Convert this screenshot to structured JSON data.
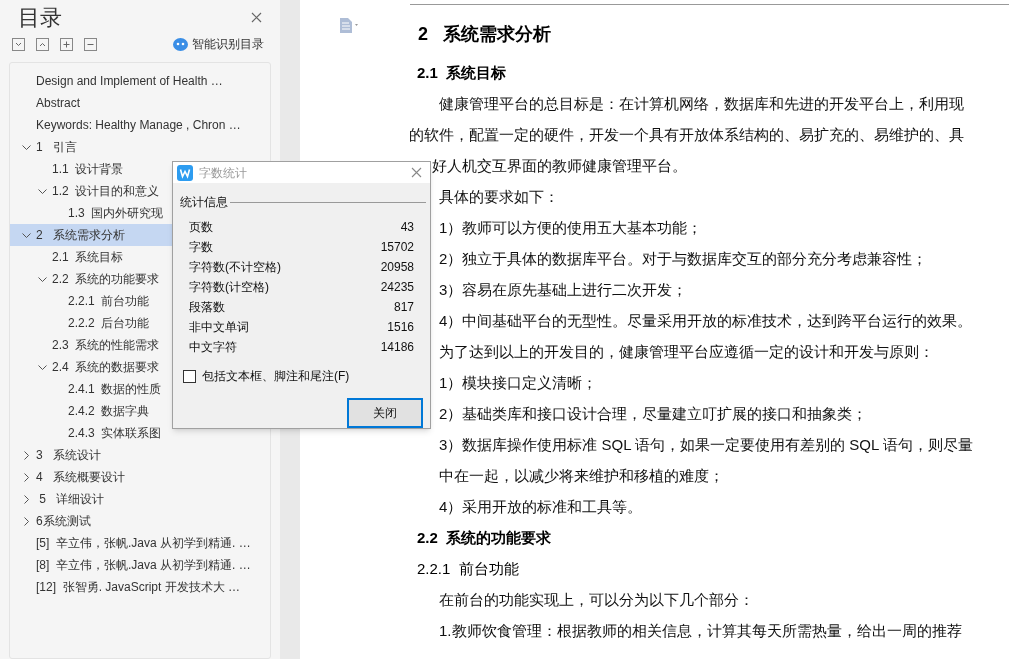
{
  "toc_panel": {
    "title": "目录",
    "smart_button": "智能识别目录",
    "items": [
      {
        "label": "Design and Implement of Health …",
        "selected": false
      },
      {
        "label": "Abstract",
        "selected": false
      },
      {
        "label": "Keywords: Healthy Manage , Chron …",
        "selected": false
      },
      {
        "label": "1   引言",
        "selected": false,
        "expanded": true,
        "children": [
          {
            "label": "1.1  设计背景",
            "selected": false
          },
          {
            "label": "1.2  设计目的和意义",
            "selected": false,
            "expanded": true,
            "children": [
              {
                "label": "1.3  国内外研究现",
                "selected": false
              }
            ]
          }
        ]
      },
      {
        "label": "2   系统需求分析",
        "selected": true,
        "expanded": true,
        "children": [
          {
            "label": "2.1  系统目标",
            "selected": false
          },
          {
            "label": "2.2  系统的功能要求",
            "selected": false,
            "expanded": true,
            "children": [
              {
                "label": "2.2.1  前台功能",
                "selected": false
              },
              {
                "label": "2.2.2  后台功能",
                "selected": false
              }
            ]
          },
          {
            "label": "2.3  系统的性能需求",
            "selected": false
          },
          {
            "label": "2.4  系统的数据要求",
            "selected": false,
            "expanded": true,
            "children": [
              {
                "label": "2.4.1  数据的性质",
                "selected": false
              },
              {
                "label": "2.4.2  数据字典",
                "selected": false
              },
              {
                "label": "2.4.3  实体联系图",
                "selected": false
              }
            ]
          }
        ]
      },
      {
        "label": "3   系统设计",
        "selected": false,
        "expanded": false
      },
      {
        "label": "4   系统概要设计",
        "selected": false,
        "expanded": false
      },
      {
        "label": " 5   详细设计",
        "selected": false,
        "expanded": false
      },
      {
        "label": "6系统测试",
        "selected": false,
        "expanded": false
      },
      {
        "label": "[5]  辛立伟，张帆.Java 从初学到精通. …",
        "selected": false
      },
      {
        "label": "[8]  辛立伟，张帆.Java 从初学到精通. …",
        "selected": false
      },
      {
        "label": "[12]  张智勇. JavaScript 开发技术大 …",
        "selected": false
      }
    ]
  },
  "document": {
    "lines": [
      {
        "kind": "heading1",
        "text": "2   系统需求分析"
      },
      {
        "kind": "heading2",
        "text": "2.1  系统目标"
      },
      {
        "kind": "indented",
        "text": "健康管理平台的总目标是：在计算机网络，数据库和先进的开发平台上，利用现"
      },
      {
        "kind": "plain",
        "text": "的软件，配置一定的硬件，开发一个具有开放体系结构的、易扩充的、易维护的、具"
      },
      {
        "kind": "partial",
        "text": "好人机交互界面的教师健康管理平台。"
      },
      {
        "kind": "indented",
        "text": "具体的要求如下："
      },
      {
        "kind": "indented",
        "text": "1）教师可以方便的使用五大基本功能；"
      },
      {
        "kind": "indented",
        "text": "2）独立于具体的数据库平台。对于与数据库交互的部分充分考虑兼容性；"
      },
      {
        "kind": "indented",
        "text": "3）容易在原先基础上进行二次开发；"
      },
      {
        "kind": "indented",
        "text": "4）中间基础平台的无型性。尽量采用开放的标准技术，达到跨平台运行的效果。"
      },
      {
        "kind": "indented",
        "text": "为了达到以上的开发目的，健康管理平台应遵循一定的设计和开发与原则："
      },
      {
        "kind": "indented",
        "text": "1）模块接口定义清晰；"
      },
      {
        "kind": "indented",
        "text": "2）基础类库和接口设计合理，尽量建立叮扩展的接口和抽象类；"
      },
      {
        "kind": "indented",
        "text": "3）数据库操作使用标准 SQL 语句，如果一定要使用有差别的 SQL 语句，则尽量"
      },
      {
        "kind": "indented",
        "text": "中在一起，以减少将来维护和移植的难度；"
      },
      {
        "kind": "indented",
        "text": "4）采用开放的标准和工具等。"
      },
      {
        "kind": "heading2",
        "text": "2.2  系统的功能要求"
      },
      {
        "kind": "heading3",
        "text": "2.2.1  前台功能"
      },
      {
        "kind": "indented",
        "text": "在前台的功能实现上，可以分为以下几个部分："
      },
      {
        "kind": "indented",
        "text": "1.教师饮食管理：根据教师的相关信息，计算其每天所需热量，给出一周的推荐"
      }
    ]
  },
  "dialog": {
    "title": "字数统计",
    "group_label": "统计信息",
    "stats": [
      {
        "label": "页数",
        "value": "43"
      },
      {
        "label": "字数",
        "value": "15702"
      },
      {
        "label": "字符数(不计空格)",
        "value": "20958"
      },
      {
        "label": "字符数(计空格)",
        "value": "24235"
      },
      {
        "label": "段落数",
        "value": "817"
      },
      {
        "label": "非中文单词",
        "value": "1516"
      },
      {
        "label": "中文字符",
        "value": "14186"
      }
    ],
    "checkbox": {
      "label": "包括文本框、脚注和尾注(F)",
      "checked": false
    },
    "close_button": "关闭"
  }
}
